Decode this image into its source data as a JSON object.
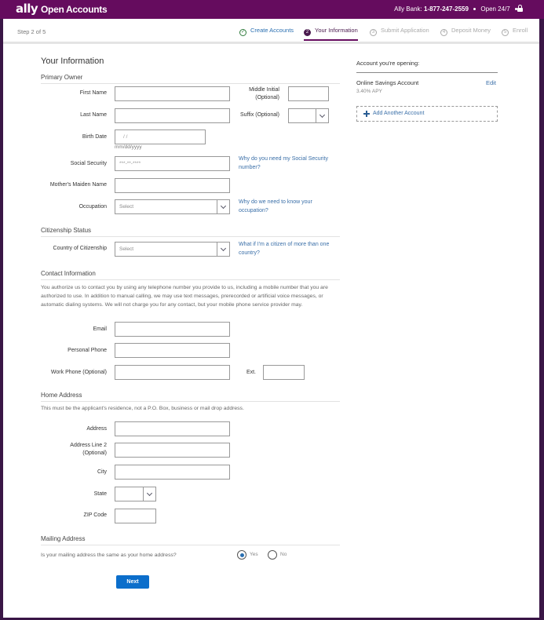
{
  "header": {
    "logo": "ally",
    "app_title": "Open Accounts",
    "contact_prefix": "Ally Bank:",
    "phone": "1-877-247-2559",
    "hours": "Open 24/7"
  },
  "progress": {
    "step_count": "Step 2 of 5",
    "steps": [
      {
        "num": "✓",
        "label": "Create Accounts",
        "state": "done"
      },
      {
        "num": "2",
        "label": "Your Information",
        "state": "active"
      },
      {
        "num": "3",
        "label": "Submit Application",
        "state": "upcoming"
      },
      {
        "num": "4",
        "label": "Deposit Money",
        "state": "upcoming"
      },
      {
        "num": "5",
        "label": "Enroll",
        "state": "upcoming"
      }
    ]
  },
  "page_title": "Your Information",
  "primary_owner": {
    "section_title": "Primary Owner",
    "first_name_label": "First Name",
    "first_name_value": "",
    "middle_initial_label_1": "Middle Initial",
    "middle_initial_label_2": "(Optional)",
    "middle_initial_value": "",
    "last_name_label": "Last Name",
    "last_name_value": "",
    "suffix_label": "Suffix (Optional)",
    "suffix_value": "",
    "birth_date_label": "Birth Date",
    "birth_date_placeholder": " /  /",
    "birth_date_hint": "mm/dd/yyyy",
    "ssn_label": "Social Security",
    "ssn_placeholder": "***-**-****",
    "ssn_help_1": "Why do you need my Social Security",
    "ssn_help_2": "number?",
    "maiden_label": "Mother's Maiden Name",
    "maiden_value": "",
    "occupation_label": "Occupation",
    "occupation_value": "Select",
    "occupation_help_1": "Why do we need to know your",
    "occupation_help_2": "occupation?"
  },
  "citizenship": {
    "section_title": "Citizenship Status",
    "country_label": "Country of Citizenship",
    "country_value": "Select",
    "help_1": "What if I'm a citizen of more than one",
    "help_2": "country?"
  },
  "contact": {
    "section_title": "Contact Information",
    "disclaimer_1": "You authorize us to contact you by using any telephone number you provide to us, including a mobile number that you are",
    "disclaimer_2": "authorized to use. In addition to manual calling, we may use text messages, prerecorded or artificial voice messages, or",
    "disclaimer_3": "automatic dialing systems. We will not charge you for any contact, but your mobile phone service provider may.",
    "email_label": "Email",
    "email_value": "",
    "personal_phone_label": "Personal Phone",
    "personal_phone_value": "",
    "work_phone_label": "Work Phone (Optional)",
    "work_phone_value": "",
    "ext_label": "Ext.",
    "ext_value": ""
  },
  "home_address": {
    "section_title": "Home Address",
    "note": "This must be the applicant's residence, not a P.O. Box, business or mail drop address.",
    "address_label": "Address",
    "address_value": "",
    "address2_label_1": "Address Line 2",
    "address2_label_2": "(Optional)",
    "address2_value": "",
    "city_label": "City",
    "city_value": "",
    "state_label": "State",
    "state_value": "",
    "zip_label": "ZIP Code",
    "zip_value": ""
  },
  "mailing_address": {
    "section_title": "Mailing Address",
    "question": "Is your mailing address the same as your home address?",
    "yes_label": "Yes",
    "no_label": "No",
    "selected": "Yes"
  },
  "next_label": "Next",
  "sidebar": {
    "title": "Account you're opening:",
    "account_name": "Online Savings Account",
    "apy": "3.40% APY",
    "edit_label": "Edit",
    "add_account_label": "Add Another Account"
  },
  "colors": {
    "brand_purple": "#650c5e",
    "link_blue": "#3a6fa8",
    "button_blue": "#0b6ecb"
  }
}
